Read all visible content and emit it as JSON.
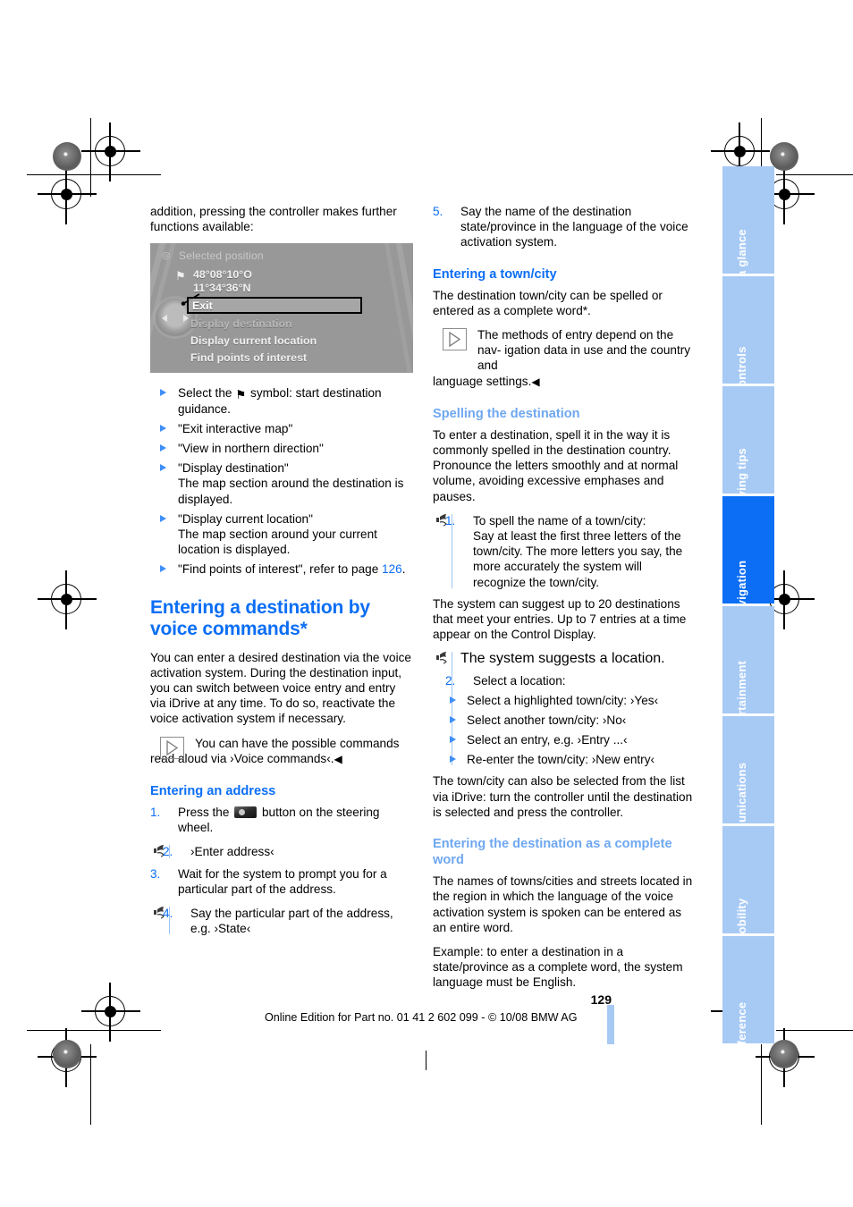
{
  "document": {
    "page_number": "129",
    "footer": "Online Edition for Part no. 01 41 2 602 099 - © 10/08 BMW AG"
  },
  "left_column": {
    "intro_paragraph": "addition, pressing the controller makes further functions available:",
    "nav_display": {
      "header": "Selected position",
      "coords_line1": "48°08°10°O",
      "coords_line2": "11°34°36°N",
      "selected_item": "Exit",
      "items": [
        "Display destination",
        "Display current location",
        "Find points of interest"
      ]
    },
    "bullets": [
      {
        "text": "Select the   symbol: start destination guidance.",
        "has_symbol": true,
        "before_symbol": "Select the",
        "after_symbol": "symbol: start destination guidance.",
        "detail": ""
      },
      {
        "text": "\"Exit interactive map\"",
        "detail": ""
      },
      {
        "text": "\"View in northern direction\"",
        "detail": ""
      },
      {
        "text": "\"Display destination\"",
        "detail": "The map section around the destination is displayed."
      },
      {
        "text": "\"Display current location\"",
        "detail": "The map section around your current location is displayed."
      },
      {
        "text": "\"Find points of interest\", refer to page ",
        "page_ref": "126",
        "suffix": ".",
        "detail": ""
      }
    ],
    "section_title": "Entering a destination by voice commands*",
    "section_paragraph": "You can enter a desired destination via the voice activation system. During the destination input, you can switch between voice entry and entry via iDrive at any time. To do so, reactivate the voice activation system if necessary.",
    "note": "You can have the possible commands read aloud via ›Voice commands‹.",
    "note_endmark": "◀",
    "address_heading": "Entering an address",
    "address_steps": [
      {
        "num": "1.",
        "prefix": "Press the",
        "has_button": true,
        "suffix": "button on the steering wheel.",
        "voice": false
      },
      {
        "num": "2.",
        "text": "›Enter address‹",
        "voice": true
      },
      {
        "num": "3.",
        "text": "Wait for the system to prompt you for a particular part of the address.",
        "voice": false
      },
      {
        "num": "4.",
        "text": "Say the particular part of the address, e.g. ›State‹",
        "voice": true
      }
    ]
  },
  "right_column": {
    "step5": {
      "num": "5.",
      "text": "Say the name of the destination state/province in the language of the voice activation system."
    },
    "town_heading": "Entering a town/city",
    "town_paragraph": "The destination town/city can be spelled or entered as a complete word*.",
    "town_note_line1": "The methods of entry depend on the nav-",
    "town_note_line2": "igation data in use and the country and",
    "town_note_line3": "language settings.",
    "town_note_endmark": "◀",
    "spelling_heading": "Spelling the destination",
    "spelling_paragraph": "To enter a destination, spell it in the way it is commonly spelled in the destination country. Pronounce the letters smoothly and at normal volume, avoiding excessive emphases and pauses.",
    "spelling_step1": {
      "num": "1.",
      "line1": "To spell the name of a town/city:",
      "line2": "Say at least the first three letters of the town/city. The more letters you say, the more accurately the system will recognize the town/city."
    },
    "suggest_paragraph": "The system can suggest up to 20 destinations that meet your entries. Up to 7 entries at a time appear on the Control Display.",
    "system_suggests": "The system suggests a location.",
    "step2": {
      "num": "2.",
      "text": "Select a location:"
    },
    "location_options": [
      "Select a highlighted town/city: ›Yes‹",
      "Select another town/city: ›No‹",
      "Select an entry, e.g. ›Entry  ...‹",
      "Re-enter the town/city: ›New entry‹"
    ],
    "idrive_paragraph": "The town/city can also be selected from the list via iDrive: turn the controller until the destination is selected and press the controller.",
    "complete_word_heading": "Entering the destination as a complete word",
    "complete_word_paragraph1": "The names of towns/cities and streets located in the region in which the language of the voice activation system is spoken can be entered as an entire word.",
    "complete_word_paragraph2": "Example: to enter a destination in a state/province as a complete word, the system language must be English."
  },
  "index_tabs": {
    "active": "Navigation",
    "items": [
      {
        "label": "At a glance",
        "active": false
      },
      {
        "label": "Controls",
        "active": false
      },
      {
        "label": "Driving tips",
        "active": false
      },
      {
        "label": "Navigation",
        "active": true
      },
      {
        "label": "Entertainment",
        "active": false
      },
      {
        "label": "Communications",
        "active": false
      },
      {
        "label": "Mobility",
        "active": false
      },
      {
        "label": "Reference",
        "active": false
      }
    ]
  },
  "colors": {
    "accent_blue": "#0b6ef5",
    "light_blue": "#a7caf5",
    "sub_heading_light": "#6fa8f0"
  }
}
